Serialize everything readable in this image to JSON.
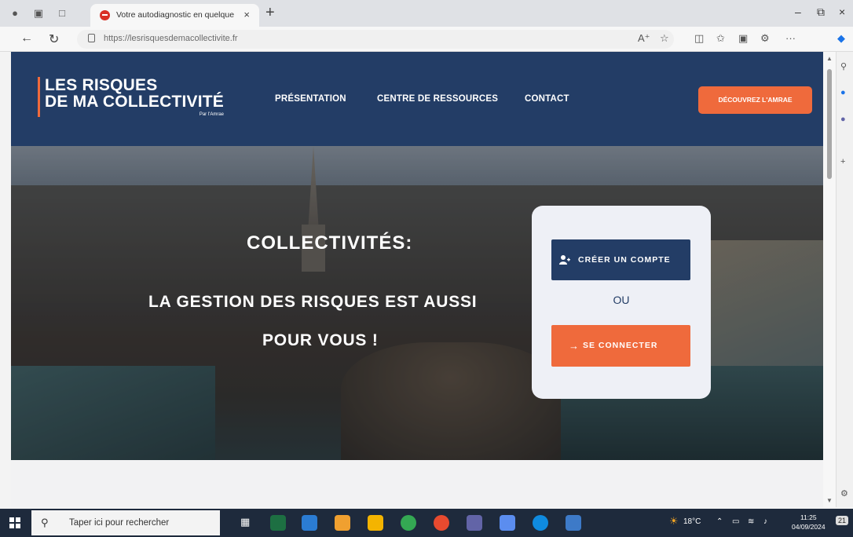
{
  "browser": {
    "tab_title": "Votre autodiagnostic en quelque",
    "url_host": "https://lesrisquesdemacollectivite",
    "url_rest": ".fr"
  },
  "header": {
    "logo_line1": "LES RISQUES",
    "logo_line2": "DE MA COLLECTIVITÉ",
    "logo_by": "Par l'Amrae",
    "nav": [
      "PRÉSENTATION",
      "CENTRE DE RESSOURCES",
      "CONTACT"
    ],
    "cta_label": "DÉCOUVREZ L'AMRAE"
  },
  "hero": {
    "line1": "COLLECTIVITÉS:",
    "line2": "LA GESTION DES RISQUES EST AUSSI",
    "line3": "POUR VOUS !"
  },
  "card": {
    "create_label": "CRÉER UN COMPTE",
    "or_label": "OU",
    "login_label": "SE CONNECTER"
  },
  "taskbar": {
    "search_placeholder": "Taper ici pour rechercher",
    "weather": "18°C",
    "time": "11:25",
    "date": "04/09/2024",
    "notification_count": "21"
  },
  "colors": {
    "navy": "#233d66",
    "orange": "#ef6a3c",
    "card_bg": "#eef0f6"
  },
  "icons": {
    "add_user": "add-user-icon",
    "arrow": "arrow-right-icon"
  }
}
